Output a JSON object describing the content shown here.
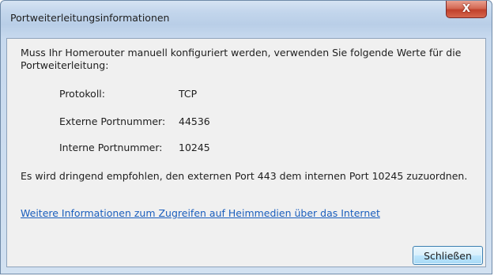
{
  "window": {
    "title": "Portweiterleitungsinformationen",
    "close_glyph": "X"
  },
  "content": {
    "intro": "Muss Ihr Homerouter manuell konfiguriert werden, verwenden Sie folgende Werte für die Portweiterleitung:",
    "fields": [
      {
        "label": "Protokoll:",
        "value": "TCP"
      },
      {
        "label": "Externe Portnummer:",
        "value": "44536"
      },
      {
        "label": "Interne Portnummer:",
        "value": "10245"
      }
    ],
    "recommendation": "Es wird dringend empfohlen, den externen Port 443 dem internen Port 10245 zuzuordnen.",
    "link_text": "Weitere Informationen zum Zugreifen auf Heimmedien über das Internet"
  },
  "buttons": {
    "close_label": "Schließen"
  },
  "colors": {
    "link": "#1a5ebd",
    "close_button": "#c1412c",
    "client_bg": "#f0f0f0"
  }
}
